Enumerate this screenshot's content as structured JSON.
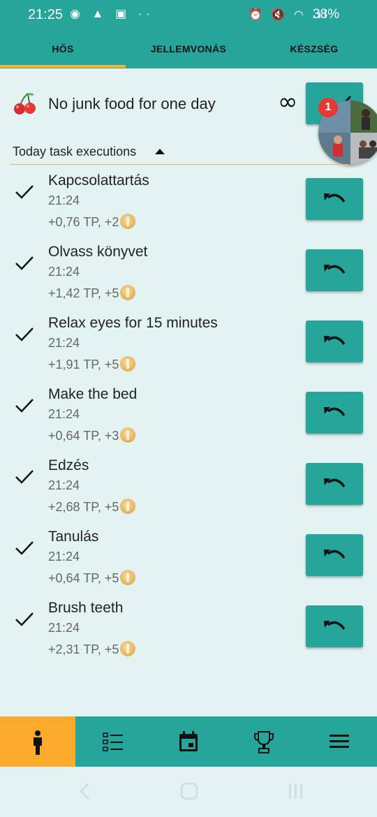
{
  "status_bar": {
    "time": "21:25",
    "left_icons": "◉ ▲ ▣ ··",
    "right_icons": "⏰ 🔇 ◠ .ıl",
    "battery": "38%"
  },
  "tabs": [
    {
      "label": "HŐS",
      "selected": true
    },
    {
      "label": "JELLEMVONÁS",
      "selected": false
    },
    {
      "label": "KÉSZSÉG",
      "selected": false
    }
  ],
  "habit": {
    "icon": "cherry-icon",
    "title": "No junk food for one day",
    "repeat_symbol": "∞",
    "action_icon": "check-icon"
  },
  "chat_head": {
    "badge": "1"
  },
  "section": {
    "title": "Today task executions",
    "expanded": true
  },
  "tasks": [
    {
      "name": "Kapcsolattartás",
      "time": "21:24",
      "reward": "+0,76 TP, +2"
    },
    {
      "name": "Olvass könyvet",
      "time": "21:24",
      "reward": "+1,42 TP, +5"
    },
    {
      "name": "Relax eyes for 15 minutes",
      "time": "21:24",
      "reward": "+1,91 TP, +5"
    },
    {
      "name": "Make the bed",
      "time": "21:24",
      "reward": "+0,64 TP, +3"
    },
    {
      "name": "Edzés",
      "time": "21:24",
      "reward": "+2,68 TP, +5"
    },
    {
      "name": "Tanulás",
      "time": "21:24",
      "reward": "+0,64 TP, +5"
    },
    {
      "name": "Brush teeth",
      "time": "21:24",
      "reward": "+2,31 TP, +5"
    }
  ],
  "bottom_nav": [
    {
      "icon": "person-icon",
      "active": true
    },
    {
      "icon": "checklist-icon",
      "active": false
    },
    {
      "icon": "calendar-icon",
      "active": false
    },
    {
      "icon": "trophy-icon",
      "active": false
    },
    {
      "icon": "menu-icon",
      "active": false
    }
  ],
  "colors": {
    "primary": "#26a69a",
    "accent": "#fbaa2a",
    "background": "#e3f3f2",
    "badge": "#e53935"
  }
}
